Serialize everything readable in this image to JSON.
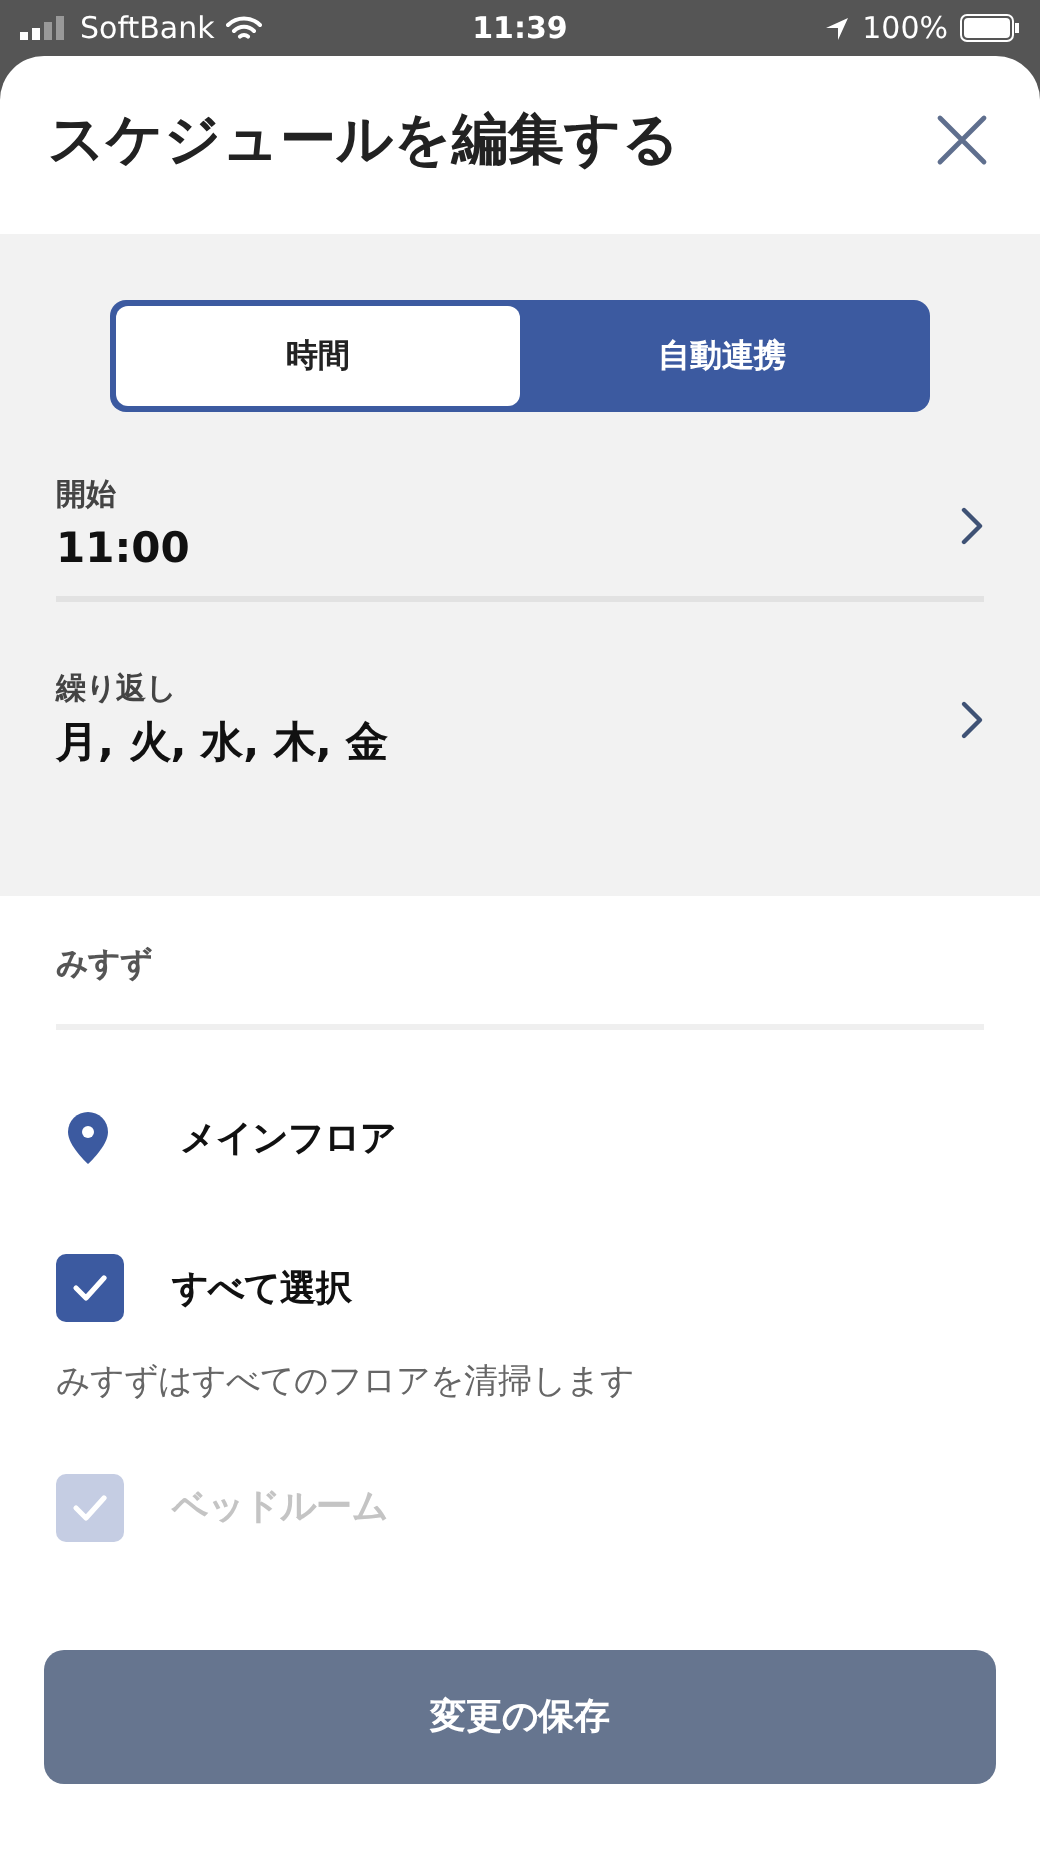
{
  "status_bar": {
    "carrier": "SoftBank",
    "time": "11:39",
    "battery": "100%"
  },
  "title": "スケジュールを編集する",
  "segments": [
    {
      "label": "時間",
      "selected": true
    },
    {
      "label": "自動連携",
      "selected": false
    }
  ],
  "settings": [
    {
      "label": "開始",
      "value": "11:00"
    },
    {
      "label": "繰り返し",
      "value": "月, 火, 水, 木, 金"
    }
  ],
  "robot_name": "みすず",
  "floor": "メインフロア",
  "select_all": {
    "label": "すべて選択",
    "checked": true
  },
  "note": "みすずはすべてのフロアを清掃します",
  "rooms": [
    {
      "label": "ベッドルーム",
      "checked": true,
      "disabled": true
    }
  ],
  "save_button": {
    "label": "変更の保存",
    "disabled": true
  }
}
